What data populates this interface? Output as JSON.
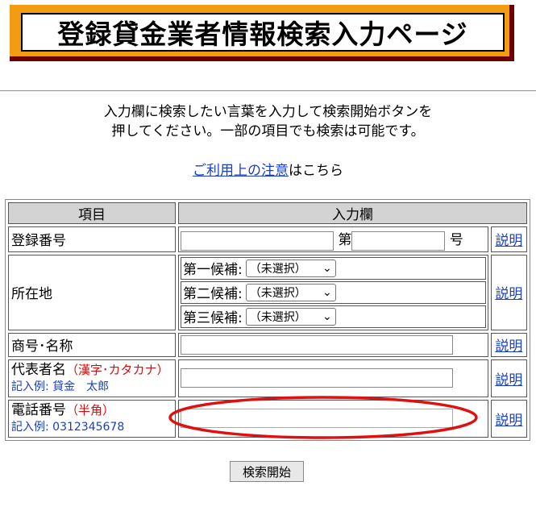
{
  "banner": {
    "title": "登録貸金業者情報検索入力ページ"
  },
  "intro": {
    "line1": "入力欄に検索したい言葉を入力して検索開始ボタンを",
    "line2": "押してください。一部の項目でも検索は可能です。"
  },
  "notice": {
    "link": "ご利用上の注意",
    "suffix": "はこちら"
  },
  "table": {
    "header_item": "項目",
    "header_input": "入力欄",
    "explain": "説明",
    "reg": {
      "label": "登録番号",
      "dai": "第",
      "go": "号"
    },
    "addr": {
      "label": "所在地",
      "candidates": [
        {
          "label": "第一候補:",
          "value": "（未選択）"
        },
        {
          "label": "第二候補:",
          "value": "（未選択）"
        },
        {
          "label": "第三候補:",
          "value": "（未選択）"
        }
      ]
    },
    "name": {
      "label": "商号･名称"
    },
    "rep": {
      "label": "代表者名",
      "note": "（漢字･カタカナ）",
      "example": "記入例: 貸金　太郎"
    },
    "tel": {
      "label": "電話番号",
      "note": "（半角）",
      "example": "記入例: 0312345678"
    }
  },
  "submit": {
    "label": "検索開始"
  },
  "colors": {
    "banner_bg": "#f39c12",
    "banner_shadow": "#6b0000",
    "link": "#1a3ec4",
    "annotation": "#e01010"
  }
}
